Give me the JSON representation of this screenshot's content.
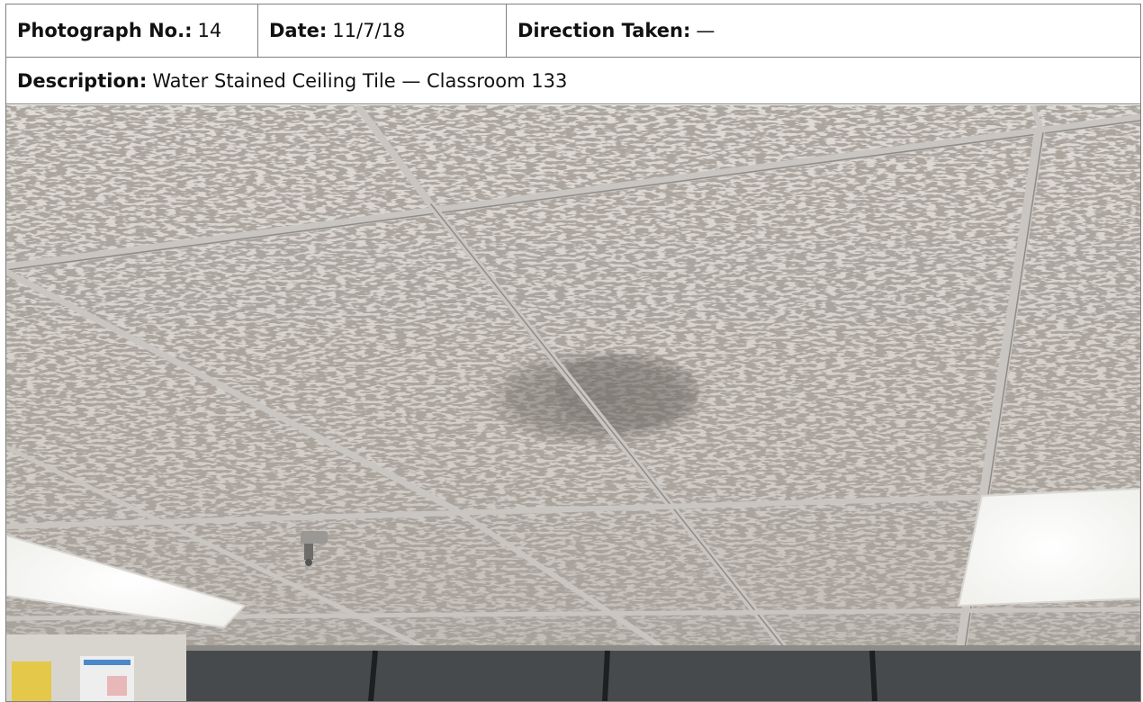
{
  "photo_log": {
    "photograph_no_label": "Photograph No.:",
    "photograph_no_value": "14",
    "date_label": "Date:",
    "date_value": "11/7/18",
    "direction_label": "Direction Taken:",
    "direction_value": "—",
    "description_label": "Description:",
    "description_value": "Water Stained Ceiling Tile — Classroom 133"
  }
}
